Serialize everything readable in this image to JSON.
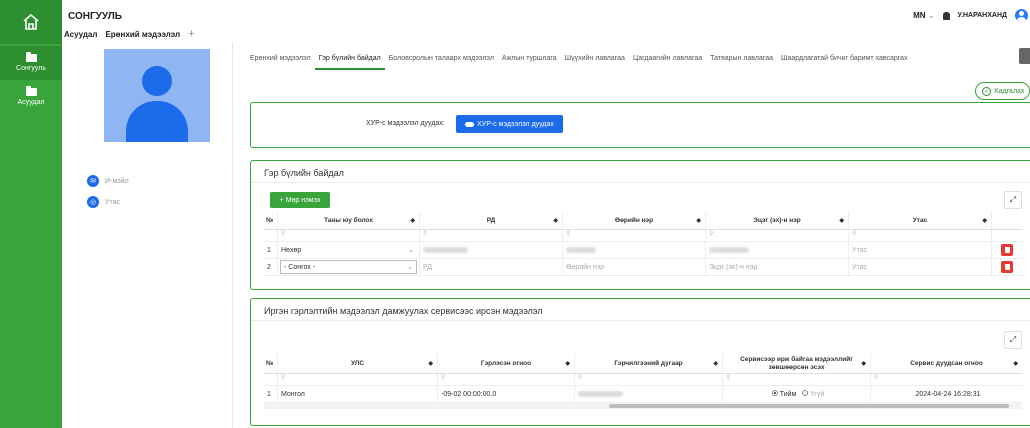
{
  "app": {
    "title": "СОНГУУЛЬ",
    "lang": "MN",
    "username": "У.НАРАНХАНД"
  },
  "breadcrumb": {
    "items": [
      "Асуудал",
      "Ерөнхий мэдээлэл"
    ]
  },
  "sidebar": {
    "items": [
      {
        "label": "Сонгууль"
      },
      {
        "label": "Асуудал"
      }
    ]
  },
  "profile": {
    "email_label": "И-мэйл",
    "phone_label": "Утас"
  },
  "tabs": [
    "Ерөнхий мэдээлэл",
    "Гэр бүлийн байдал",
    "Боловсролын талаарх мэдээлэл",
    "Ажлын туршлага",
    "Шүүхийн лавлагаа",
    "Цагдаагийн лавлагаа",
    "Татварын лавлагаа",
    "Шаардлагатай бичиг баримт хавсаргах"
  ],
  "save_label": "Хадгалах",
  "xyp": {
    "label": "ХУР-с мэдээлэл дуудах:",
    "button": "ХУР-с мэдээлэл дуудах"
  },
  "family": {
    "title": "Гэр бүлийн байдал",
    "add_label": "Мөр нэмэх",
    "columns": [
      "№",
      "Таны юу болох",
      "РД",
      "Өөрийн нэр",
      "Эцэг (эх)-н нэр",
      "Утас"
    ],
    "rows": [
      {
        "no": "1",
        "relation": "Нөхөр",
        "rd": "",
        "name": "",
        "father": "",
        "phone": "Утас"
      },
      {
        "no": "2",
        "relation": "- Сонгох -",
        "rd": "РД",
        "name": "Өөрийн нэр",
        "father": "Эцэг (эх)-н нэр",
        "phone": "Утас"
      }
    ]
  },
  "marriage": {
    "title": "Иргэн гэрлэлтийн мэдээлэл дамжуулах сервисээс ирсэн мэдээлэл",
    "columns": [
      "№",
      "УЛС",
      "Гэрлэсэн огноо",
      "Гэрчилгээний дугаар",
      "Сервисээр ирж байгаа мэдээллийг зөвшөөрсөн эсэх",
      "Сервис дуудсан огноо"
    ],
    "row": {
      "no": "1",
      "country": "Монгол",
      "date": "-09-02 00:00:00.0",
      "cert": "",
      "yes": "Тийм",
      "no_opt": "Үгүй",
      "called": "2024-04-24 16:28:31"
    }
  },
  "colors": {
    "green": "#3aa43c",
    "blue": "#1c6bea",
    "red": "#e53935"
  }
}
